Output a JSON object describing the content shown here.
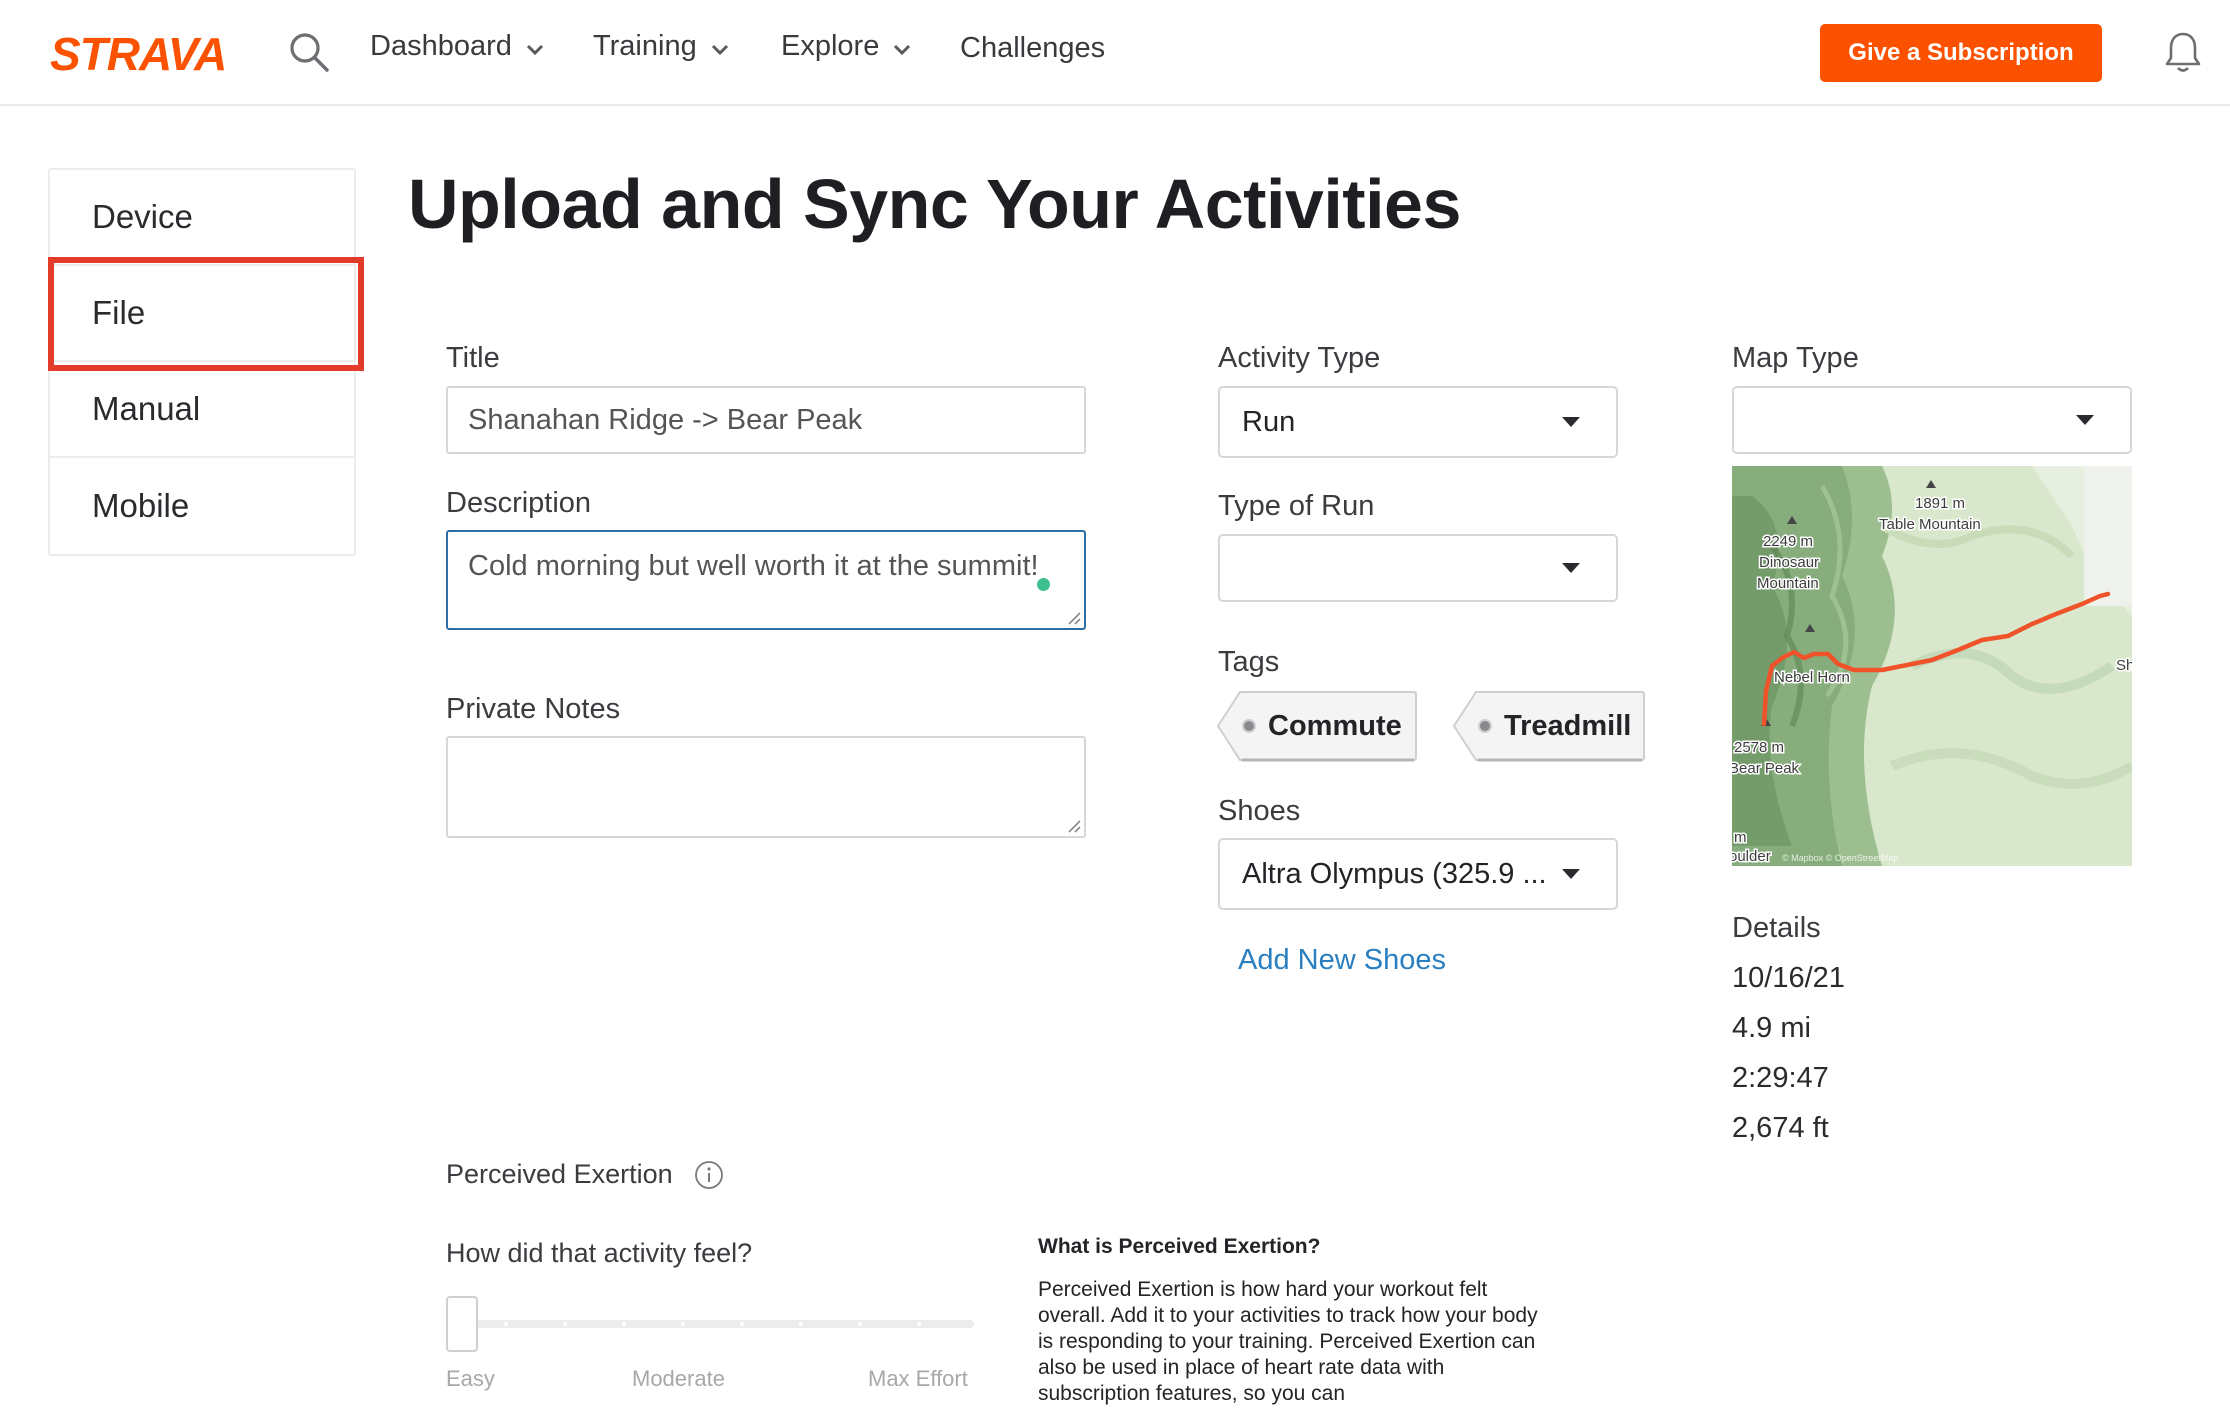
{
  "header": {
    "logo_text": "STRAVA",
    "nav": [
      {
        "label": "Dashboard"
      },
      {
        "label": "Training"
      },
      {
        "label": "Explore"
      },
      {
        "label": "Challenges"
      }
    ],
    "subscription_button": "Give a Subscription",
    "brand_color": "#fc5200"
  },
  "sidebar": {
    "tabs": [
      {
        "label": "Device"
      },
      {
        "label": "File"
      },
      {
        "label": "Manual"
      },
      {
        "label": "Mobile"
      }
    ],
    "highlight_color": "#e33b2a"
  },
  "page": {
    "title": "Upload and Sync Your Activities"
  },
  "form": {
    "title_label": "Title",
    "title_value": "Shanahan Ridge -> Bear Peak",
    "description_label": "Description",
    "description_value": "Cold morning but well worth it at the summit!",
    "private_notes_label": "Private Notes",
    "private_notes_value": "",
    "activity_type_label": "Activity Type",
    "activity_type_value": "Run",
    "type_of_run_label": "Type of Run",
    "type_of_run_value": "",
    "tags_label": "Tags",
    "tags": [
      "Commute",
      "Treadmill"
    ],
    "shoes_label": "Shoes",
    "shoes_value": "Altra Olympus (325.9 ...",
    "add_shoes_link": "Add New Shoes",
    "map_type_label": "Map Type",
    "map_type_value": ""
  },
  "map": {
    "labels": {
      "table_mountain_elev": "1891 m",
      "table_mountain": "Table Mountain",
      "dinosaur_elev": "2249 m",
      "dinosaur_1": "Dinosaur",
      "dinosaur_2": "Mountain",
      "nebel_horn": "Nebel Horn",
      "bear_peak_elev": "2578 m",
      "bear_peak": "Bear Peak",
      "edge_right": "Sh",
      "edge_bottom": "m",
      "boulder": "oulder",
      "attribution": "© Mapbox © OpenStreetMap"
    },
    "route_color": "#f0522a"
  },
  "details": {
    "label": "Details",
    "date": "10/16/21",
    "distance": "4.9 mi",
    "time": "2:29:47",
    "elevation": "2,674 ft"
  },
  "exertion": {
    "label": "Perceived Exertion",
    "question": "How did that activity feel?",
    "level": 0,
    "scale_labels": [
      "Easy",
      "Moderate",
      "Max Effort"
    ],
    "help_title": "What is Perceived Exertion?",
    "help_text": "Perceived Exertion is how hard your workout felt overall. Add it to your activities to track how your body is responding to your training. Perceived Exertion can also be used in place of heart rate data with subscription features, so you can"
  }
}
